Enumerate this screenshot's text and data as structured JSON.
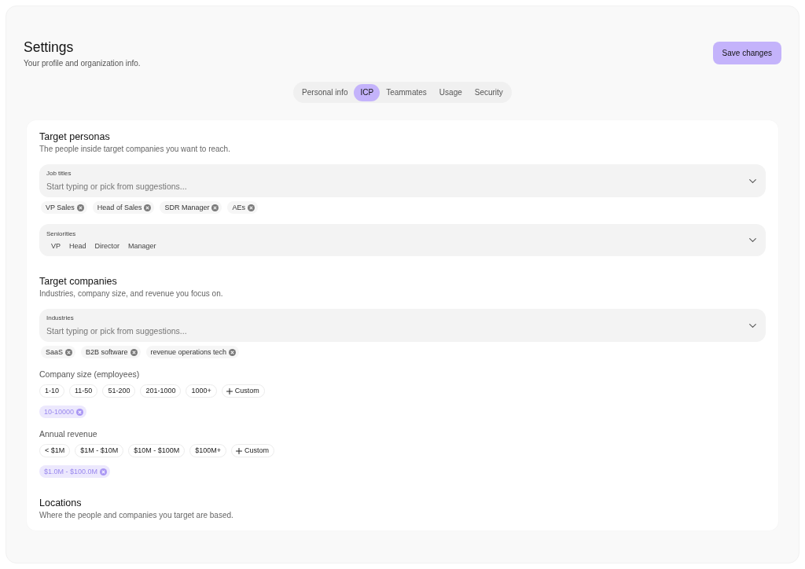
{
  "page": {
    "title": "Settings",
    "subtitle": "Your profile and organization info.",
    "save_button": "Save changes"
  },
  "tabs": [
    {
      "label": "Personal info",
      "selected": false
    },
    {
      "label": "ICP",
      "selected": true
    },
    {
      "label": "Teammates",
      "selected": false
    },
    {
      "label": "Usage",
      "selected": false
    },
    {
      "label": "Security",
      "selected": false
    }
  ],
  "sections": [
    {
      "title": "Target personas",
      "subtitle": "The people inside target companies you want to reach.",
      "blocks": [
        {
          "kind": "select",
          "label": "Job titles",
          "placeholder": "Start typing or pick from suggestions...",
          "tags": [
            "VP Sales",
            "Head of Sales",
            "SDR Manager",
            "AEs"
          ]
        },
        {
          "kind": "multiselect",
          "label": "Seniorities",
          "options": [
            "VP",
            "Head",
            "Director",
            "Manager"
          ]
        }
      ]
    },
    {
      "title": "Target companies",
      "subtitle": "Industries, company size, and revenue you focus on.",
      "blocks": [
        {
          "kind": "select",
          "label": "Industries",
          "placeholder": "Start typing or pick from suggestions...",
          "tags": [
            "SaaS",
            "B2B software",
            "revenue operations tech"
          ]
        },
        {
          "kind": "presets",
          "label": "Company size (employees)",
          "options": [
            "1-10",
            "11-50",
            "51-200",
            "201-1000",
            "1000+"
          ],
          "custom": "Custom",
          "values": [
            "10-10000"
          ]
        },
        {
          "kind": "presets",
          "label": "Annual revenue",
          "options": [
            "< $1M",
            "$1M - $10M",
            "$10M - $100M",
            "$100M+"
          ],
          "custom": "Custom",
          "values": [
            "$1.0M - $100.0M"
          ]
        }
      ]
    },
    {
      "title": "Locations",
      "subtitle": "Where the people and companies you target are based."
    }
  ]
}
